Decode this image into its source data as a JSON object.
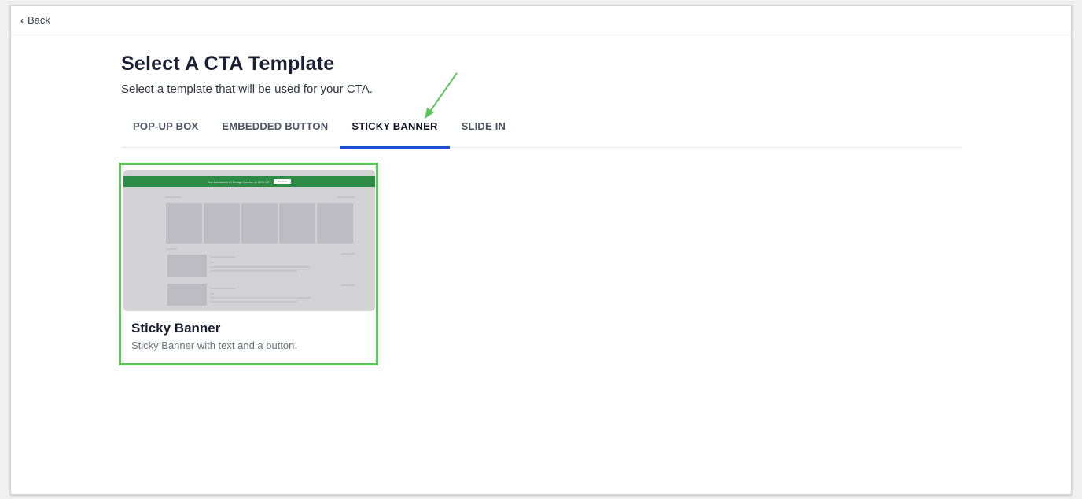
{
  "nav": {
    "back_label": "Back"
  },
  "page": {
    "title": "Select A CTA Template",
    "subtitle": "Select a template that will be used for your CTA."
  },
  "tabs": [
    {
      "label": "POP-UP BOX",
      "active": false
    },
    {
      "label": "EMBEDDED BUTTON",
      "active": false
    },
    {
      "label": "STICKY BANNER",
      "active": true
    },
    {
      "label": "SLIDE IN",
      "active": false
    }
  ],
  "templates": [
    {
      "title": "Sticky Banner",
      "description": "Sticky Banner with text and a button.",
      "selected": true,
      "preview": {
        "banner_text": "Buy Advanced UI Design Course at 50% Off",
        "banner_button": "Buy Now"
      }
    }
  ],
  "colors": {
    "accent_tab": "#1d4ed8",
    "card_highlight": "#5cc45a",
    "annotation_arrow": "#5cc45a",
    "banner_green": "#2e8b46"
  }
}
